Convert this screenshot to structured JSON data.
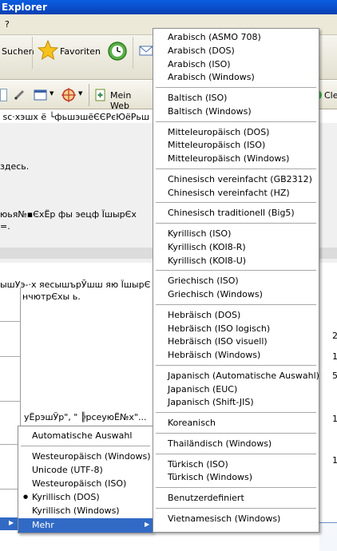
{
  "window": {
    "title": "Explorer",
    "menu_hint": "?"
  },
  "toolbar": {
    "search_label": "Suchen",
    "favorites_label": "Favoriten"
  },
  "linkbar": {
    "myweb_label": "Mein Web",
    "right_partial": "Cle"
  },
  "page": {
    "lines": [
      " ѕc·хэшх ё  └фьшэшёЄЄРєЮёРьш",
      "здесь.",
      "юья№▪ЄхЁр фы  эецф ЇшырЄх",
      "=.",
      "ышУэ-·х яесышърЎшш яю ЇшырЄ",
      "нчютрЄхы ь.",
      "уЁрэшЎр\", \" ╠рсеуюЁ№х\"..."
    ],
    "right_digits": [
      "2",
      "1",
      "5",
      "1",
      "1"
    ]
  },
  "encoding_menu": {
    "items": [
      "Automatische Auswahl",
      "Westeuropäisch (Windows)",
      "Unicode (UTF-8)",
      "Westeuropäisch (ISO)",
      "Kyrillisch (DOS)",
      "Kyrillisch (Windows)",
      "Mehr"
    ],
    "checked": "Kyrillisch (DOS)",
    "highlighted": "Mehr",
    "bullet": "●",
    "arrow": "▶"
  },
  "more_menu": {
    "groups": [
      [
        "Arabisch (ASMO 708)",
        "Arabisch (DOS)",
        "Arabisch (ISO)",
        "Arabisch (Windows)"
      ],
      [
        "Baltisch (ISO)",
        "Baltisch (Windows)"
      ],
      [
        "Mitteleuropäisch (DOS)",
        "Mitteleuropäisch (ISO)",
        "Mitteleuropäisch (Windows)"
      ],
      [
        "Chinesisch vereinfacht (GB2312)",
        "Chinesisch vereinfacht (HZ)"
      ],
      [
        "Chinesisch traditionell  (Big5)"
      ],
      [
        "Kyrillisch (ISO)",
        "Kyrillisch (KOI8-R)",
        "Kyrillisch (KOI8-U)"
      ],
      [
        "Griechisch (ISO)",
        "Griechisch (Windows)"
      ],
      [
        "Hebräisch (DOS)",
        "Hebräisch (ISO logisch)",
        "Hebräisch (ISO visuell)",
        "Hebräisch (Windows)"
      ],
      [
        "Japanisch (Automatische Auswahl)",
        "Japanisch (EUC)",
        "Japanisch (Shift-JIS)"
      ],
      [
        "Koreanisch"
      ],
      [
        "Thailändisch (Windows)"
      ],
      [
        "Türkisch (ISO)",
        "Türkisch (Windows)"
      ],
      [
        "Benutzerdefiniert"
      ],
      [
        "Vietnamesisch (Windows)"
      ]
    ]
  }
}
